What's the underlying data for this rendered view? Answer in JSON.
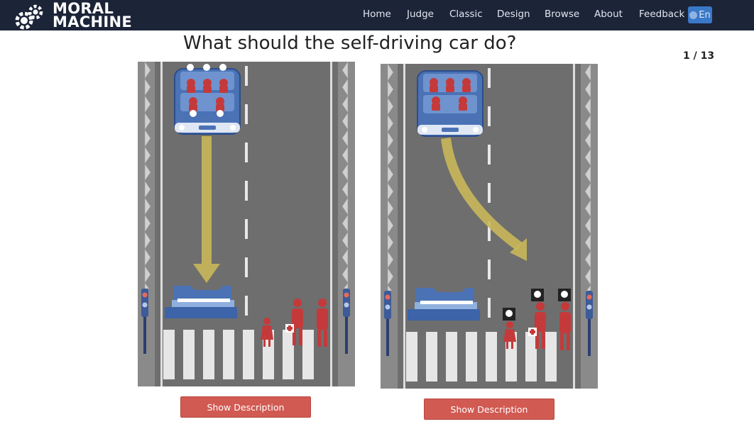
{
  "brand": {
    "line1": "MORAL",
    "line2": "MACHINE"
  },
  "nav": {
    "items": [
      "Home",
      "Judge",
      "Classic",
      "Design",
      "Browse",
      "About",
      "Feedback"
    ],
    "language": "En"
  },
  "page": {
    "title": "What should the self-driving car do?",
    "counter": "1 / 13"
  },
  "scenarios": [
    {
      "button_label": "Show Description"
    },
    {
      "button_label": "Show Description"
    }
  ],
  "colors": {
    "navbar": "#1c2438",
    "road": "#6e6e6e",
    "car": "#4a72b5",
    "figure": "#c43a3a",
    "arrow": "#c9b75a",
    "button": "#d15a52"
  }
}
